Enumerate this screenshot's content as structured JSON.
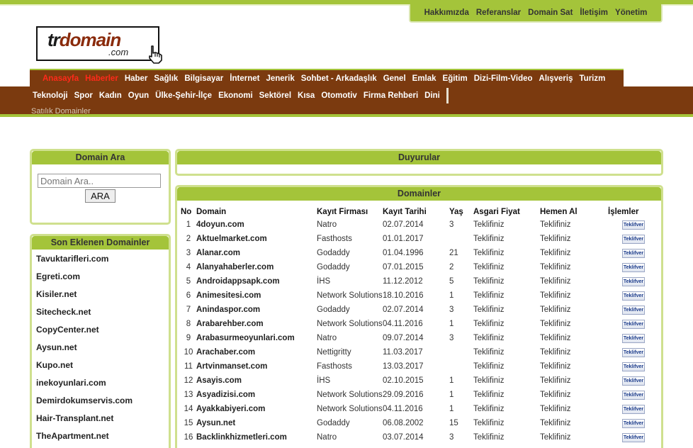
{
  "topnav": [
    "Hakkımızda",
    "Referanslar",
    "Domain Sat",
    "İletişim",
    "Yönetim"
  ],
  "logo": {
    "main_a": "tr",
    "main_b": "domain",
    "sub": ".com"
  },
  "nav_row1": [
    {
      "label": "Anasayfa",
      "active": true
    },
    {
      "label": "Haberler",
      "active": true
    },
    {
      "label": "Haber",
      "active": false
    },
    {
      "label": "Sağlık",
      "active": false
    },
    {
      "label": "Bilgisayar",
      "active": false
    },
    {
      "label": "İnternet",
      "active": false
    },
    {
      "label": "Jenerik",
      "active": false
    },
    {
      "label": "Sohbet - Arkadaşlık",
      "active": false
    },
    {
      "label": "Genel",
      "active": false
    },
    {
      "label": "Emlak",
      "active": false
    },
    {
      "label": "Eğitim",
      "active": false
    },
    {
      "label": "Dizi-Film-Video",
      "active": false
    },
    {
      "label": "Alışveriş",
      "active": false
    },
    {
      "label": "Turizm",
      "active": false
    }
  ],
  "nav_row2": [
    "Teknoloji",
    "Spor",
    "Kadın",
    "Oyun",
    "Ülke-Şehir-İlçe",
    "Ekonomi",
    "Sektörel",
    "Kısa",
    "Otomotiv",
    "Firma Rehberi",
    "Dini"
  ],
  "breadcrumb": "Satılık Domainler",
  "search_box": {
    "title": "Domain Ara",
    "placeholder": "Domain Ara..",
    "button": "ARA"
  },
  "recent_box": {
    "title": "Son Eklenen Domainler",
    "items": [
      "Tavuktarifleri.com",
      "Egreti.com",
      "Kisiler.net",
      "Sitecheck.net",
      "CopyCenter.net",
      "Aysun.net",
      "Kupo.net",
      "inekoyunlari.com",
      "Demirdokumservis.com",
      "Hair-Transplant.net",
      "TheApartment.net"
    ]
  },
  "announcements": {
    "title": "Duyurular"
  },
  "domains": {
    "title": "Domainler",
    "headers": [
      "No",
      "Domain",
      "Kayıt Firması",
      "Kayıt Tarihi",
      "Yaş",
      "Asgari Fiyat",
      "Hemen Al",
      "İşlemler"
    ],
    "action_label": "Teklifver",
    "rows": [
      {
        "no": "1",
        "domain": "4doyun.com",
        "firma": "Natro",
        "tarih": "02.07.2014",
        "yas": "3",
        "fiyat": "Teklifiniz",
        "hemen": "Teklifiniz"
      },
      {
        "no": "2",
        "domain": "Aktuelmarket.com",
        "firma": "Fasthosts",
        "tarih": "01.01.2017",
        "yas": "",
        "fiyat": "Teklifiniz",
        "hemen": "Teklifiniz"
      },
      {
        "no": "3",
        "domain": "Alanar.com",
        "firma": "Godaddy",
        "tarih": "01.04.1996",
        "yas": "21",
        "fiyat": "Teklifiniz",
        "hemen": "Teklifiniz"
      },
      {
        "no": "4",
        "domain": "Alanyahaberler.com",
        "firma": "Godaddy",
        "tarih": "07.01.2015",
        "yas": "2",
        "fiyat": "Teklifiniz",
        "hemen": "Teklifiniz"
      },
      {
        "no": "5",
        "domain": "Androidappsapk.com",
        "firma": "İHS",
        "tarih": "11.12.2012",
        "yas": "5",
        "fiyat": "Teklifiniz",
        "hemen": "Teklifiniz"
      },
      {
        "no": "6",
        "domain": "Animesitesi.com",
        "firma": "Network Solutions",
        "tarih": "18.10.2016",
        "yas": "1",
        "fiyat": "Teklifiniz",
        "hemen": "Teklifiniz"
      },
      {
        "no": "7",
        "domain": "Anindaspor.com",
        "firma": "Godaddy",
        "tarih": "02.07.2014",
        "yas": "3",
        "fiyat": "Teklifiniz",
        "hemen": "Teklifiniz"
      },
      {
        "no": "8",
        "domain": "Arabarehber.com",
        "firma": "Network Solutions",
        "tarih": "04.11.2016",
        "yas": "1",
        "fiyat": "Teklifiniz",
        "hemen": "Teklifiniz"
      },
      {
        "no": "9",
        "domain": "Arabasurmeoyunlari.com",
        "firma": "Natro",
        "tarih": "09.07.2014",
        "yas": "3",
        "fiyat": "Teklifiniz",
        "hemen": "Teklifiniz"
      },
      {
        "no": "10",
        "domain": "Arachaber.com",
        "firma": "Nettigritty",
        "tarih": "11.03.2017",
        "yas": "",
        "fiyat": "Teklifiniz",
        "hemen": "Teklifiniz"
      },
      {
        "no": "11",
        "domain": "Artvinmanset.com",
        "firma": "Fasthosts",
        "tarih": "13.03.2017",
        "yas": "",
        "fiyat": "Teklifiniz",
        "hemen": "Teklifiniz"
      },
      {
        "no": "12",
        "domain": "Asayis.com",
        "firma": "İHS",
        "tarih": "02.10.2015",
        "yas": "1",
        "fiyat": "Teklifiniz",
        "hemen": "Teklifiniz"
      },
      {
        "no": "13",
        "domain": "Asyadizisi.com",
        "firma": "Network Solutions",
        "tarih": "29.09.2016",
        "yas": "1",
        "fiyat": "Teklifiniz",
        "hemen": "Teklifiniz"
      },
      {
        "no": "14",
        "domain": "Ayakkabiyeri.com",
        "firma": "Network Solutions",
        "tarih": "04.11.2016",
        "yas": "1",
        "fiyat": "Teklifiniz",
        "hemen": "Teklifiniz"
      },
      {
        "no": "15",
        "domain": "Aysun.net",
        "firma": "Godaddy",
        "tarih": "06.08.2002",
        "yas": "15",
        "fiyat": "Teklifiniz",
        "hemen": "Teklifiniz"
      },
      {
        "no": "16",
        "domain": "Backlinkhizmetleri.com",
        "firma": "Natro",
        "tarih": "03.07.2014",
        "yas": "3",
        "fiyat": "Teklifiniz",
        "hemen": "Teklifiniz"
      }
    ]
  }
}
